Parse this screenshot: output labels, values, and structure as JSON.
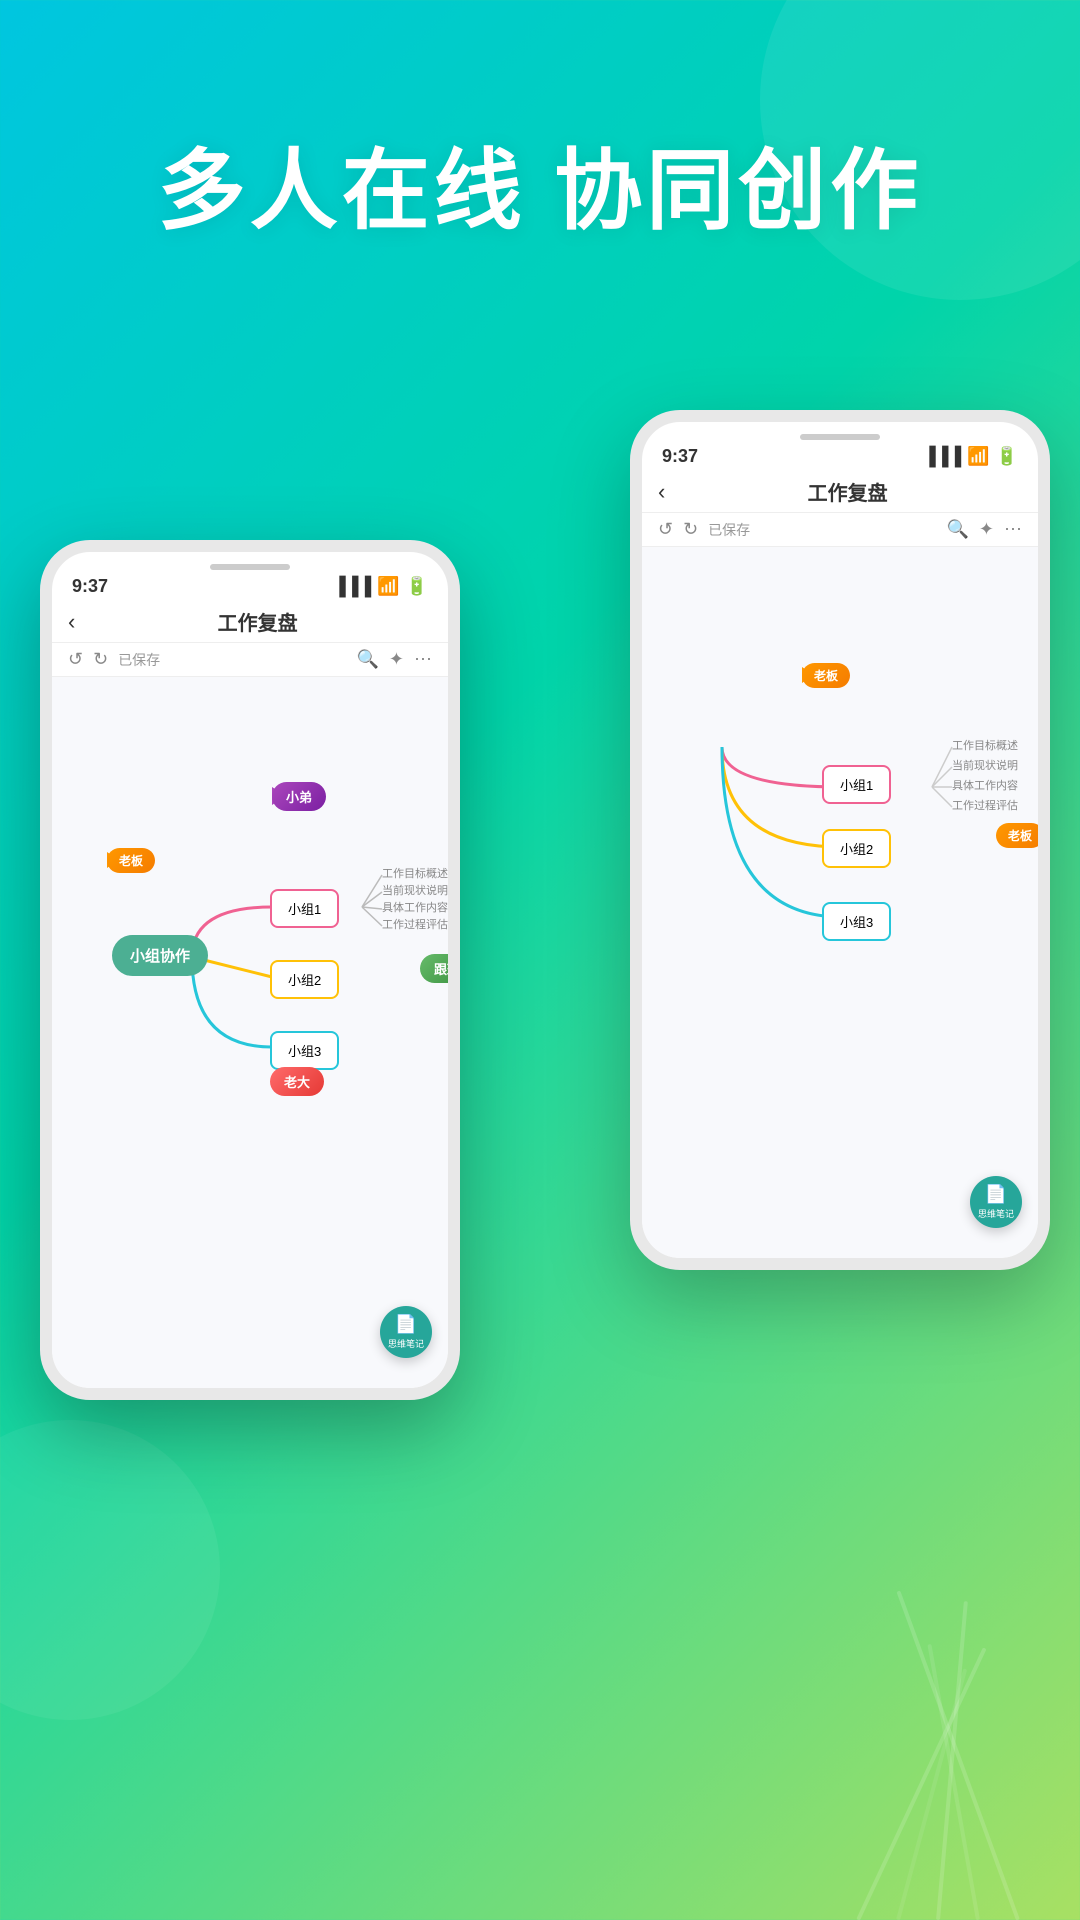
{
  "background": {
    "gradient_start": "#00c6e0",
    "gradient_end": "#a8e063"
  },
  "hero": {
    "title": "多人在线 协同创作"
  },
  "phone_back": {
    "status_time": "9:37",
    "nav_title": "工作复盘",
    "toolbar_saved": "已保存",
    "nodes": {
      "group1": "小组1",
      "group2": "小组2",
      "group3": "小组3",
      "tag_boss": "老板",
      "branch1": "工作目标概述",
      "branch2": "当前现状说明",
      "branch3": "具体工作内容",
      "branch4": "工作过程评估"
    },
    "fab_label": "思维笔记"
  },
  "phone_front": {
    "status_time": "9:37",
    "nav_title": "工作复盘",
    "toolbar_saved": "已保存",
    "nodes": {
      "center": "小组协作",
      "group1": "小组1",
      "group2": "小组2",
      "group3": "小组3",
      "tag_little_bro": "小弟",
      "tag_boss": "老板",
      "tag_follow": "跟班",
      "tag_big": "老大",
      "branch1": "工作目标概述",
      "branch2": "当前现状说明",
      "branch3": "具体工作内容",
      "branch4": "工作过程评估"
    },
    "fab_label": "思维笔记"
  }
}
